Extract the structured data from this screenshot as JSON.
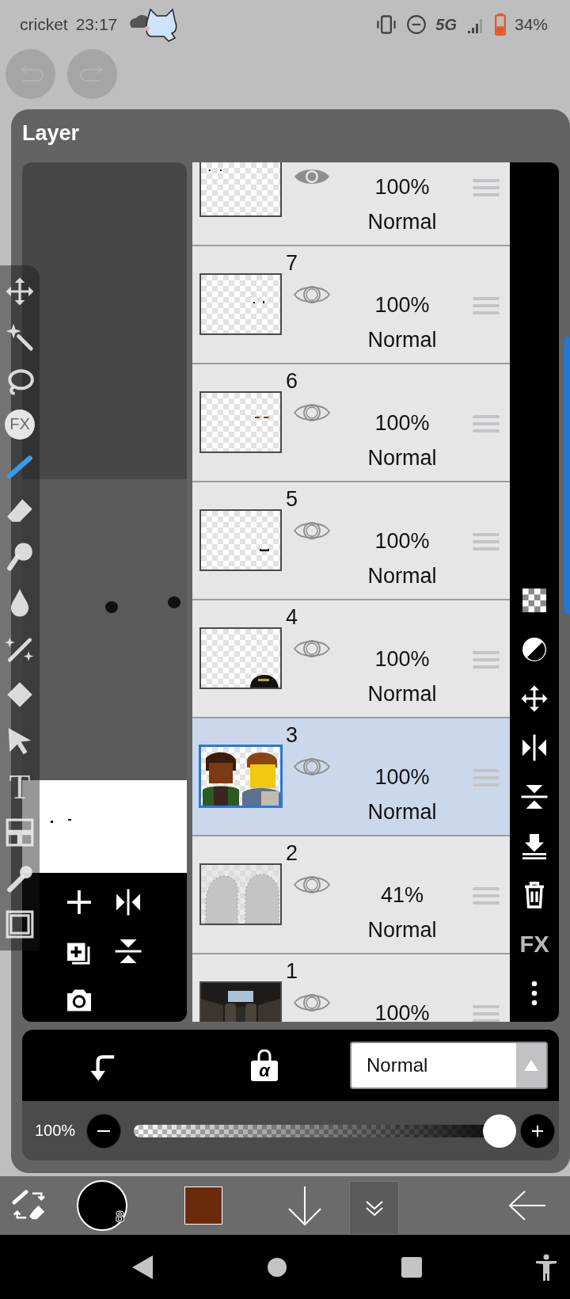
{
  "status_bar": {
    "carrier": "cricket",
    "time": "23:17",
    "network": "5G",
    "battery": "34%"
  },
  "dialog": {
    "title": "Layer"
  },
  "tools": [
    {
      "kind": "move",
      "selected": false
    },
    {
      "kind": "wand",
      "selected": false
    },
    {
      "kind": "lasso",
      "selected": false
    },
    {
      "kind": "fx",
      "label": "FX",
      "selected": false
    },
    {
      "kind": "brush",
      "selected": true
    },
    {
      "kind": "eraser",
      "selected": false
    },
    {
      "kind": "smudge",
      "selected": false
    },
    {
      "kind": "blur",
      "selected": false
    },
    {
      "kind": "sparkle",
      "selected": false
    },
    {
      "kind": "fill",
      "selected": false
    },
    {
      "kind": "select",
      "selected": false
    },
    {
      "kind": "text",
      "label": "T",
      "selected": false
    },
    {
      "kind": "frame",
      "selected": false
    },
    {
      "kind": "dropper",
      "selected": false
    },
    {
      "kind": "canvas",
      "selected": false
    }
  ],
  "preview_actions": [
    {
      "kind": "add"
    },
    {
      "kind": "flip_h"
    },
    {
      "kind": "duplicate"
    },
    {
      "kind": "flip_v"
    },
    {
      "kind": "camera"
    }
  ],
  "layers": [
    {
      "opacity": "100%",
      "blend": "Normal",
      "selected": false,
      "eye_filled": true,
      "kind": "dots_left"
    },
    {
      "number": "7",
      "opacity": "100%",
      "blend": "Normal",
      "selected": false,
      "eye_filled": false,
      "kind": "dots_right"
    },
    {
      "number": "6",
      "opacity": "100%",
      "blend": "Normal",
      "selected": false,
      "eye_filled": false,
      "kind": "brows"
    },
    {
      "number": "5",
      "opacity": "100%",
      "blend": "Normal",
      "selected": false,
      "eye_filled": false,
      "kind": "mouth"
    },
    {
      "number": "4",
      "opacity": "100%",
      "blend": "Normal",
      "selected": false,
      "eye_filled": false,
      "kind": "hair"
    },
    {
      "number": "3",
      "opacity": "100%",
      "blend": "Normal",
      "selected": true,
      "eye_filled": false,
      "kind": "figures"
    },
    {
      "number": "2",
      "opacity": "41%",
      "blend": "Normal",
      "selected": false,
      "eye_filled": false,
      "kind": "ghost"
    },
    {
      "number": "1",
      "opacity": "100%",
      "selected": false,
      "eye_filled": false
    }
  ],
  "layer_actions": [
    {
      "kind": "checker"
    },
    {
      "kind": "adjust"
    },
    {
      "kind": "move"
    },
    {
      "kind": "flip_h"
    },
    {
      "kind": "flip_v"
    },
    {
      "kind": "merge_down"
    },
    {
      "kind": "delete"
    },
    {
      "kind": "fx",
      "label": "FX"
    },
    {
      "kind": "more"
    }
  ],
  "blend_bar": {
    "alpha_lock": "α",
    "blend_mode": "Normal"
  },
  "opacity": {
    "label": "100%",
    "level": 1
  },
  "toolbar": {
    "brush_size": "8",
    "color": "#6b2a0a"
  }
}
